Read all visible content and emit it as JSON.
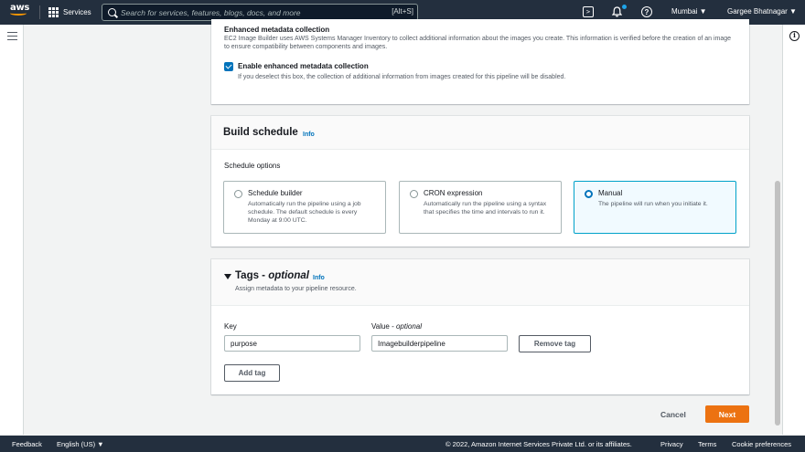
{
  "nav": {
    "logo": "aws",
    "services": "Services",
    "search_placeholder": "Search for services, features, blogs, docs, and more",
    "search_shortcut": "[Alt+S]",
    "region": "Mumbai ▼",
    "user": "Gargee Bhatnagar ▼",
    "icons": [
      "grid-icon",
      "search-icon",
      "cloudshell-icon",
      "bell-icon",
      "help-icon"
    ]
  },
  "enhanced": {
    "title": "Enhanced metadata collection",
    "description": "EC2 Image Builder uses AWS Systems Manager Inventory to collect additional information about the images you create. This information is verified before the creation of an image to ensure compatibility between components and images.",
    "checkbox_label": "Enable enhanced metadata collection",
    "checkbox_checked": true,
    "checkbox_desc": "If you deselect this box, the collection of additional information from images created for this pipeline will be disabled."
  },
  "schedule": {
    "title": "Build schedule",
    "info": "Info",
    "options_label": "Schedule options",
    "options": [
      {
        "title": "Schedule builder",
        "desc": "Automatically run the pipeline using a job schedule. The default schedule is every Monday at 9:00 UTC.",
        "selected": false
      },
      {
        "title": "CRON expression",
        "desc": "Automatically run the pipeline using a syntax that specifies the time and intervals to run it.",
        "selected": false
      },
      {
        "title": "Manual",
        "desc": "The pipeline will run when you initiate it.",
        "selected": true
      }
    ]
  },
  "tags": {
    "title_main": "Tags - ",
    "title_optional": "optional",
    "info": "Info",
    "description": "Assign metadata to your pipeline resource.",
    "key_label": "Key",
    "value_label_main": "Value - ",
    "value_label_optional": "optional",
    "key_value": "purpose",
    "value_value": "Imagebuilderpipeline",
    "remove_label": "Remove tag",
    "add_label": "Add tag"
  },
  "actions": {
    "cancel": "Cancel",
    "next": "Next"
  },
  "footer": {
    "feedback": "Feedback",
    "language": "English (US) ▼",
    "copyright": "© 2022, Amazon Internet Services Private Ltd. or its affiliates.",
    "privacy": "Privacy",
    "terms": "Terms",
    "cookies": "Cookie preferences"
  },
  "colors": {
    "nav_bg": "#232f3e",
    "accent": "#0073bb",
    "primary_button": "#ec7211"
  }
}
